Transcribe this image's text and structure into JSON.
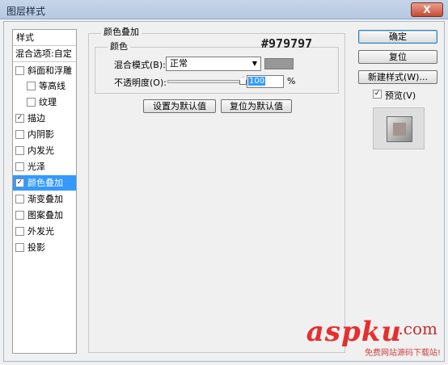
{
  "window": {
    "title": "图层样式",
    "close_label": "X"
  },
  "sidebar": {
    "header": "样式",
    "blend_options": "混合选项:自定",
    "items": [
      {
        "label": "斜面和浮雕",
        "checked": false
      },
      {
        "label": "等高线",
        "checked": false
      },
      {
        "label": "纹理",
        "checked": false
      },
      {
        "label": "描边",
        "checked": true
      },
      {
        "label": "内阴影",
        "checked": false
      },
      {
        "label": "内发光",
        "checked": false
      },
      {
        "label": "光泽",
        "checked": false
      },
      {
        "label": "颜色叠加",
        "checked": true,
        "selected": true
      },
      {
        "label": "渐变叠加",
        "checked": false
      },
      {
        "label": "图案叠加",
        "checked": false
      },
      {
        "label": "外发光",
        "checked": false
      },
      {
        "label": "投影",
        "checked": false
      }
    ],
    "check_mark": "✓"
  },
  "main": {
    "group_title": "颜色叠加",
    "sub_title": "颜色",
    "hex_annotation": "#979797",
    "blend_mode_label": "混合模式(B):",
    "blend_mode_value": "正常",
    "dropdown_arrow": "▼",
    "overlay_color": "#979797",
    "opacity_label": "不透明度(O):",
    "opacity_value": "100",
    "opacity_percent": 1.0,
    "opacity_unit": "%",
    "set_default": "设置为默认值",
    "reset_default": "复位为默认值"
  },
  "right": {
    "ok": "确定",
    "reset": "复位",
    "new_style": "新建样式(W)...",
    "preview_label": "预览(V)",
    "preview_checked": true
  },
  "watermark": {
    "brand": "aspku",
    "suffix": ".com",
    "tagline": "免费网站源码下载站!"
  }
}
